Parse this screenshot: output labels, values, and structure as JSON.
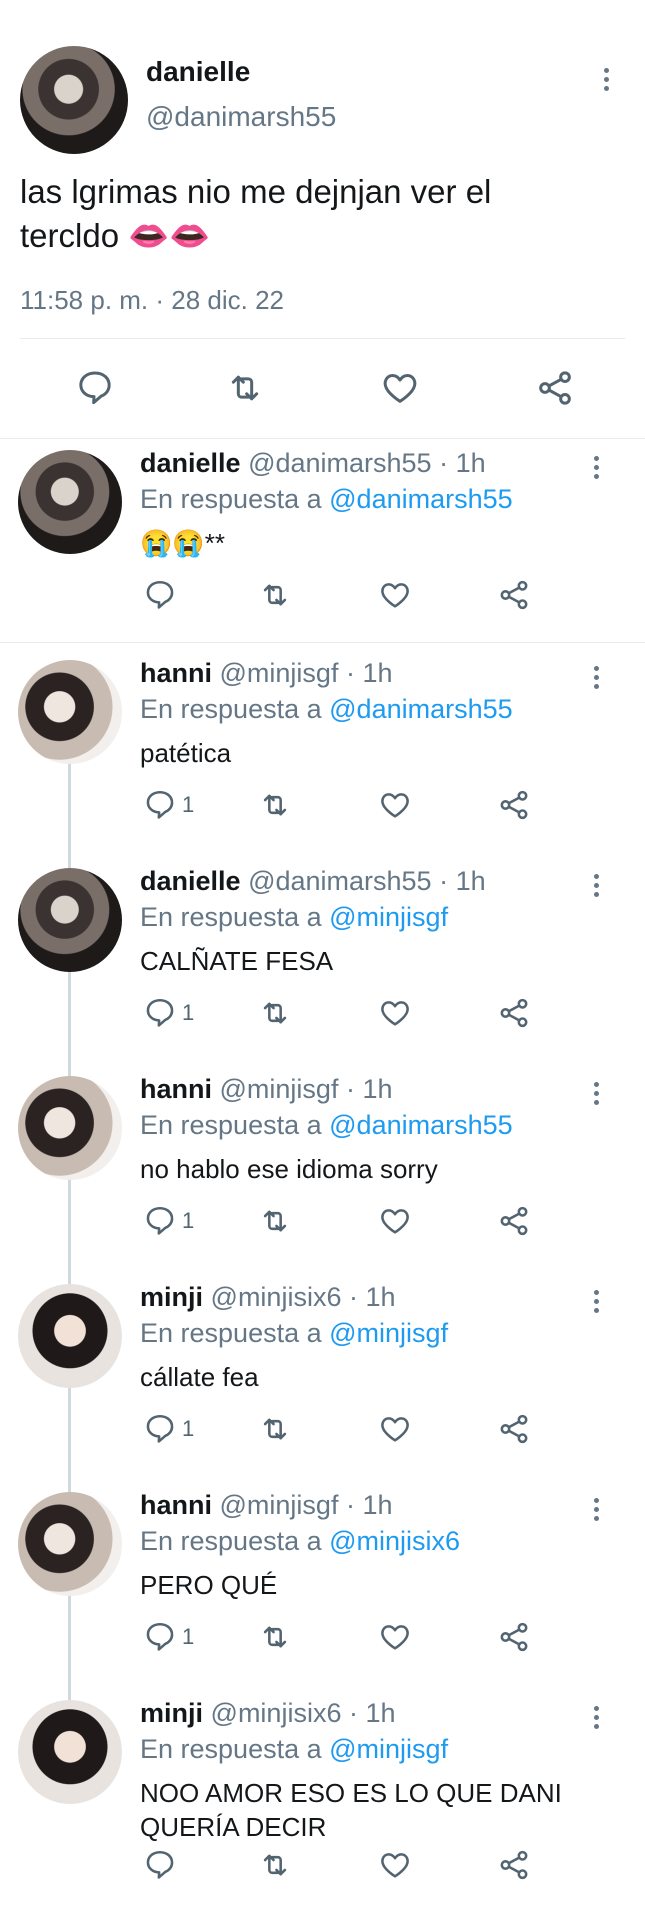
{
  "main_tweet": {
    "display_name": "danielle",
    "handle": "@danimarsh55",
    "text": "las lgrimas nio me dejnjan ver el tercldo 👄👄",
    "timestamp": "11:58 p. m. · 28 dic. 22"
  },
  "reply_prefix": "En respuesta a",
  "replies": [
    {
      "name": "danielle",
      "handle": "@danimarsh55",
      "time": "· 1h",
      "reply_to": "@danimarsh55",
      "text": "😭😭**",
      "reply_count": ""
    },
    {
      "name": "hanni",
      "handle": "@minjisgf",
      "time": "· 1h",
      "reply_to": "@danimarsh55",
      "text": "patética",
      "reply_count": "1"
    },
    {
      "name": "danielle",
      "handle": "@danimarsh55",
      "time": "· 1h",
      "reply_to": "@minjisgf",
      "text": "CALÑATE FESA",
      "reply_count": "1"
    },
    {
      "name": "hanni",
      "handle": "@minjisgf",
      "time": "· 1h",
      "reply_to": "@danimarsh55",
      "text": "no hablo ese idioma sorry",
      "reply_count": "1"
    },
    {
      "name": "minji",
      "handle": "@minjisix6",
      "time": "· 1h",
      "reply_to": "@minjisgf",
      "text": "cállate fea",
      "reply_count": "1"
    },
    {
      "name": "hanni",
      "handle": "@minjisgf",
      "time": "· 1h",
      "reply_to": "@minjisix6",
      "text": "PERO QUÉ",
      "reply_count": "1"
    },
    {
      "name": "minji",
      "handle": "@minjisix6",
      "time": "· 1h",
      "reply_to": "@minjisgf",
      "text": "NOO AMOR ESO ES LO QUE DANI\nQUERÍA DECIR",
      "reply_count": ""
    }
  ],
  "icons": [
    "reply-icon",
    "retweet-icon",
    "like-icon",
    "share-icon",
    "more-icon"
  ],
  "colors": {
    "text": "#14171a",
    "muted": "#657786",
    "link": "#1d9bf0",
    "divider": "#e6ecf0"
  }
}
